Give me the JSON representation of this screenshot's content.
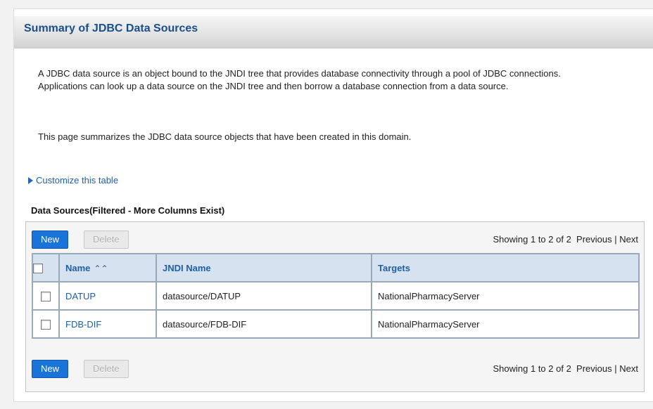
{
  "page": {
    "title": "Summary of JDBC Data Sources",
    "description_1": "A JDBC data source is an object bound to the JNDI tree that provides database connectivity through a pool of JDBC connections. Applications can look up a data source on the JNDI tree and then borrow a database connection from a data source.",
    "description_2": "This page summarizes the JDBC data source objects that have been created in this domain.",
    "customize_link": "Customize this table"
  },
  "table": {
    "title": "Data Sources(Filtered - More Columns Exist)",
    "new_label": "New",
    "delete_label": "Delete",
    "showing": "Showing 1 to 2 of 2",
    "previous": "Previous",
    "separator": "|",
    "next": "Next",
    "columns": {
      "name": "Name",
      "jndi": "JNDI Name",
      "targets": "Targets"
    },
    "sort_icon": "sort-ascending-icon",
    "rows": [
      {
        "name": "DATUP",
        "jndi": "datasource/DATUP",
        "targets": "NationalPharmacyServer"
      },
      {
        "name": "FDB-DIF",
        "jndi": "datasource/FDB-DIF",
        "targets": "NationalPharmacyServer"
      }
    ]
  },
  "colors": {
    "title_text": "#1a4f8a",
    "link": "#1f5fa8",
    "new_button": "#1a73d9",
    "header_row": "#d6e2ef"
  }
}
